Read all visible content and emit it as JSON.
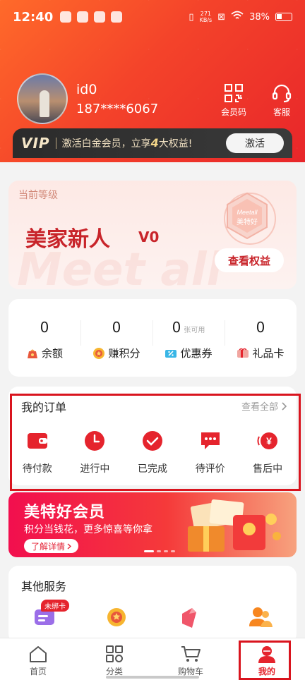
{
  "status_bar": {
    "time": "12:40",
    "network_speed_value": "271",
    "network_speed_unit": "KB/s",
    "battery": "38%"
  },
  "profile": {
    "user_id": "id0",
    "phone": "187****6067"
  },
  "top_actions": {
    "member_code_label": "会员码",
    "customer_service_label": "客服"
  },
  "vip": {
    "logo": "VIP",
    "text_prefix": "激活白金会员，立享",
    "text_number": "4",
    "text_suffix": "大权益!",
    "button_label": "激活"
  },
  "level": {
    "tag": "当前等级",
    "name": "美家新人",
    "code": "V0",
    "button_label": "查看权益",
    "watermark": "Meet all",
    "badge_text": "Meetall 美特好"
  },
  "assets": [
    {
      "value": "0",
      "note": "",
      "label": "余额",
      "icon": "wallet-bag-icon"
    },
    {
      "value": "0",
      "note": "",
      "label": "赚积分",
      "icon": "points-coin-icon"
    },
    {
      "value": "0",
      "note": "张可用",
      "label": "优惠券",
      "icon": "coupon-icon"
    },
    {
      "value": "0",
      "note": "",
      "label": "礼品卡",
      "icon": "gift-card-icon"
    }
  ],
  "orders": {
    "title": "我的订单",
    "view_all": "查看全部",
    "items": [
      {
        "label": "待付款",
        "icon": "wallet-icon"
      },
      {
        "label": "进行中",
        "icon": "clock-icon"
      },
      {
        "label": "已完成",
        "icon": "check-circle-icon"
      },
      {
        "label": "待评价",
        "icon": "comment-icon"
      },
      {
        "label": "售后中",
        "icon": "refund-icon"
      }
    ]
  },
  "banner": {
    "title": "美特好会员",
    "subtitle": "积分当钱花，更多惊喜等你拿",
    "button_label": "了解详情"
  },
  "services": {
    "title": "其他服务",
    "first_badge": "未绑卡"
  },
  "tabs": [
    {
      "label": "首页",
      "icon": "home-icon"
    },
    {
      "label": "分类",
      "icon": "category-icon"
    },
    {
      "label": "购物车",
      "icon": "cart-icon"
    },
    {
      "label": "我的",
      "icon": "user-icon"
    }
  ],
  "colors": {
    "brand_red": "#e5242d",
    "header_orange": "#ff6a2a",
    "highlight_border": "#d9141e"
  }
}
